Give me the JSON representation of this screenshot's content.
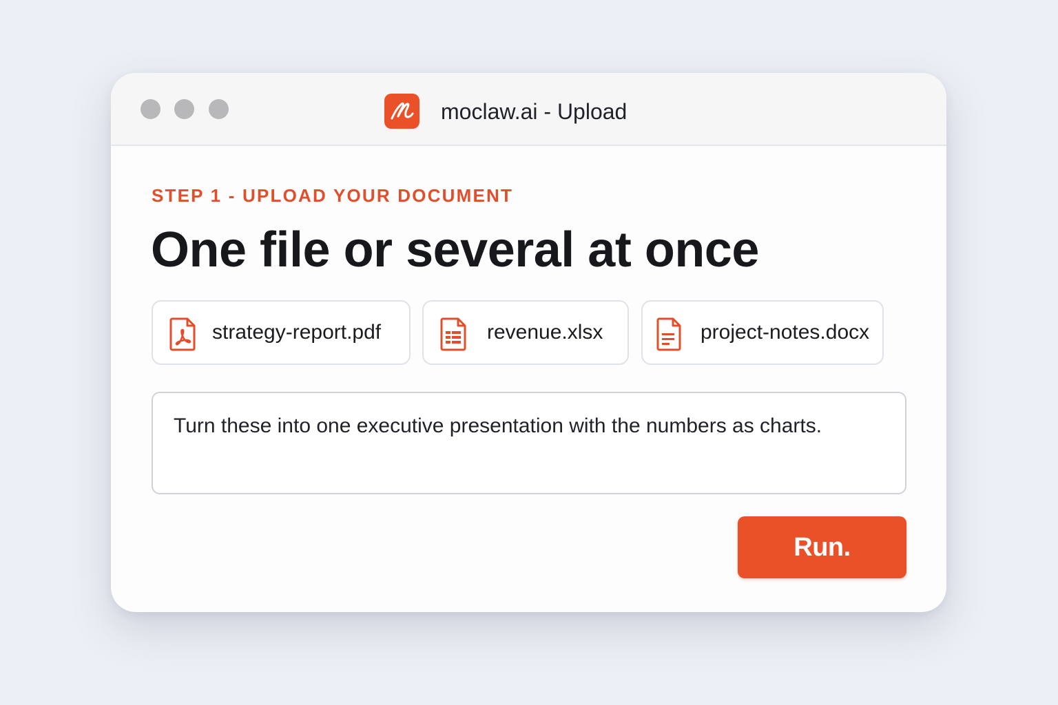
{
  "window": {
    "title": "moclaw.ai - Upload",
    "logo_icon": "moclaw-logo-icon",
    "controls": [
      "close",
      "minimize",
      "maximize"
    ]
  },
  "main": {
    "step_label": "STEP 1 - UPLOAD YOUR DOCUMENT",
    "headline": "One file or several at once",
    "files": [
      {
        "name": "strategy-report.pdf",
        "icon": "pdf-file-icon"
      },
      {
        "name": "revenue.xlsx",
        "icon": "spreadsheet-file-icon"
      },
      {
        "name": "project-notes.docx",
        "icon": "document-file-icon"
      }
    ],
    "prompt": "Turn these into one executive presentation with the numbers as charts.",
    "run_label": "Run."
  },
  "colors": {
    "accent": "#eb5128",
    "background": "#eceff5",
    "window": "#fdfdfd",
    "text": "#16181c"
  }
}
